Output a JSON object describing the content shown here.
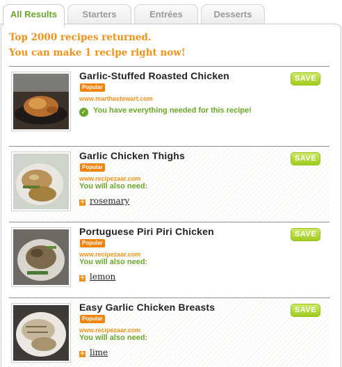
{
  "tabs": [
    {
      "label": "All Results",
      "active": true
    },
    {
      "label": "Starters",
      "active": false
    },
    {
      "label": "Entrées",
      "active": false
    },
    {
      "label": "Desserts",
      "active": false
    }
  ],
  "summary": {
    "line1": "Top 2000 recipes returned.",
    "line2": "You can make 1 recipe right now!"
  },
  "recipes": [
    {
      "title": "Garlic-Stuffed Roasted Chicken",
      "badge": "Popular",
      "source": "www.marthastewart.com",
      "status": "You have everything needed for this recipe!",
      "save_label": "SAVE",
      "image": "roasted-chicken-photo"
    },
    {
      "title": "Garlic Chicken Thighs",
      "badge": "Popular",
      "source": "www.recipezaar.com",
      "need_label": "You will also need:",
      "ingredient": "rosemary",
      "save_label": "SAVE",
      "image": "chicken-thighs-photo"
    },
    {
      "title": "Portuguese Piri Piri Chicken",
      "badge": "Popular",
      "source": "www.recipezaar.com",
      "need_label": "You will also need:",
      "ingredient": "lemon",
      "save_label": "SAVE",
      "image": "piri-piri-chicken-photo"
    },
    {
      "title": "Easy Garlic Chicken Breasts",
      "badge": "Popular",
      "source": "www.recipezaar.com",
      "need_label": "You will also need:",
      "ingredient": "lime",
      "save_label": "SAVE",
      "image": "garlic-chicken-breasts-photo"
    }
  ],
  "colors": {
    "accent_orange": "#f09119",
    "accent_green": "#6aa62b",
    "save_green": "#a6d024",
    "badge_orange": "#f0840c"
  }
}
